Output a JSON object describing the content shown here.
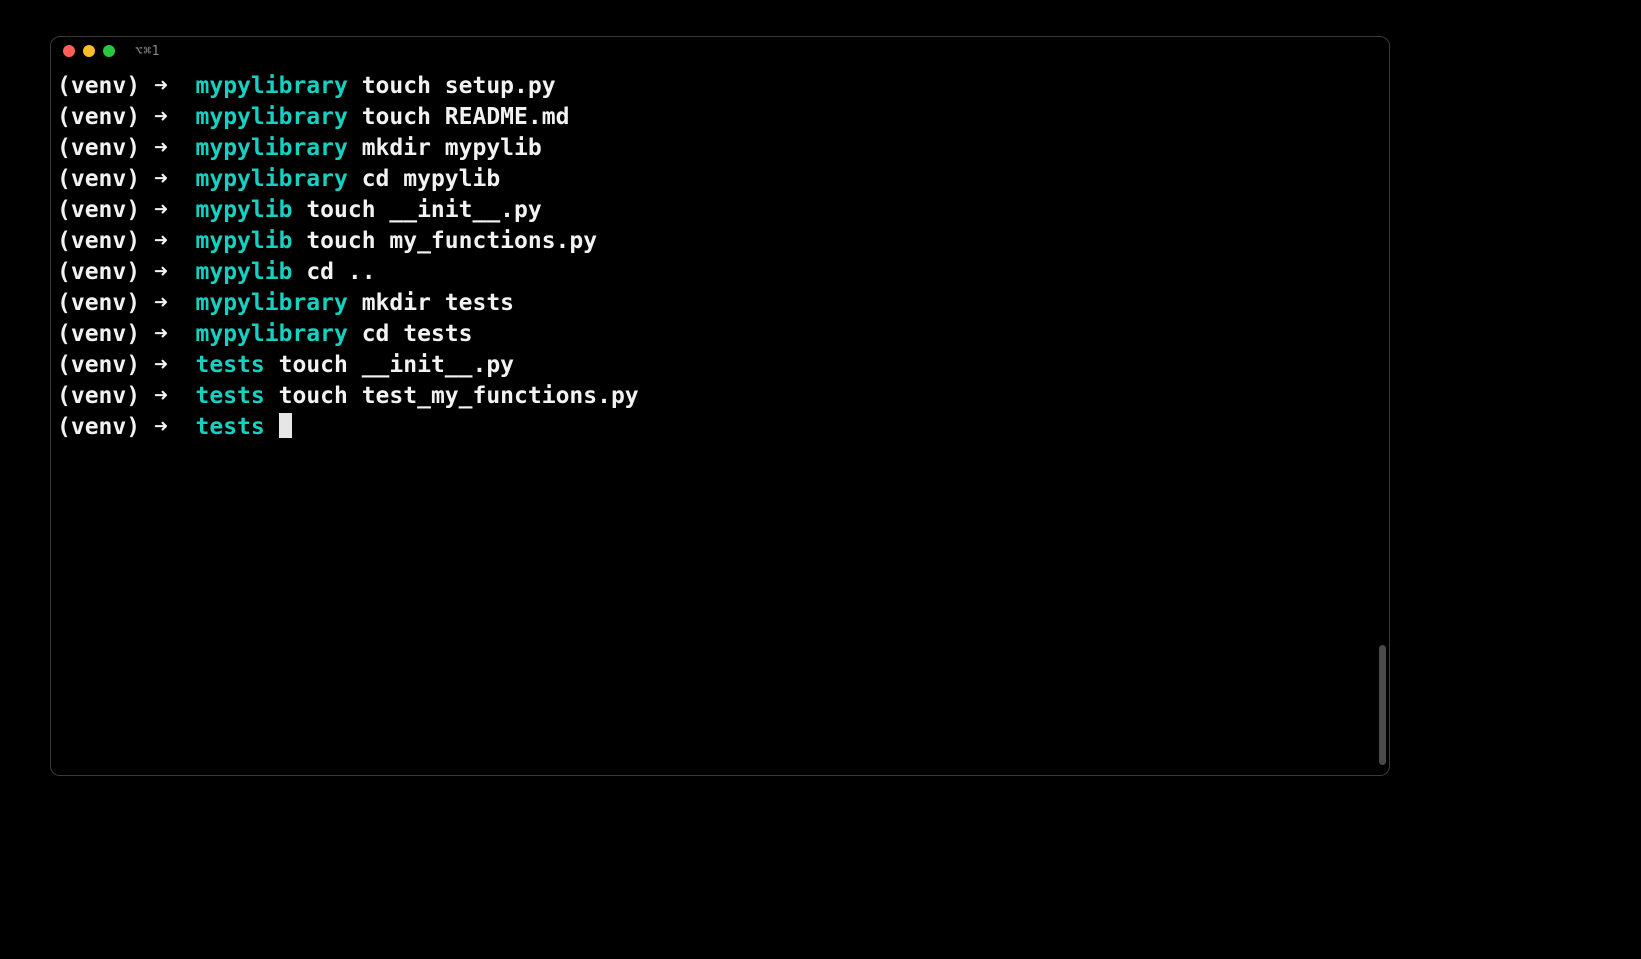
{
  "window": {
    "title": "⌥⌘1"
  },
  "prompt": {
    "venv": "(venv)",
    "arrow": "➜"
  },
  "lines": [
    {
      "dir": "mypylibrary",
      "cmd": "touch setup.py"
    },
    {
      "dir": "mypylibrary",
      "cmd": "touch README.md"
    },
    {
      "dir": "mypylibrary",
      "cmd": "mkdir mypylib"
    },
    {
      "dir": "mypylibrary",
      "cmd": "cd mypylib"
    },
    {
      "dir": "mypylib",
      "cmd": "touch __init__.py"
    },
    {
      "dir": "mypylib",
      "cmd": "touch my_functions.py"
    },
    {
      "dir": "mypylib",
      "cmd": "cd .."
    },
    {
      "dir": "mypylibrary",
      "cmd": "mkdir tests"
    },
    {
      "dir": "mypylibrary",
      "cmd": "cd tests"
    },
    {
      "dir": "tests",
      "cmd": "touch __init__.py"
    },
    {
      "dir": "tests",
      "cmd": "touch test_my_functions.py"
    }
  ],
  "current": {
    "dir": "tests"
  }
}
